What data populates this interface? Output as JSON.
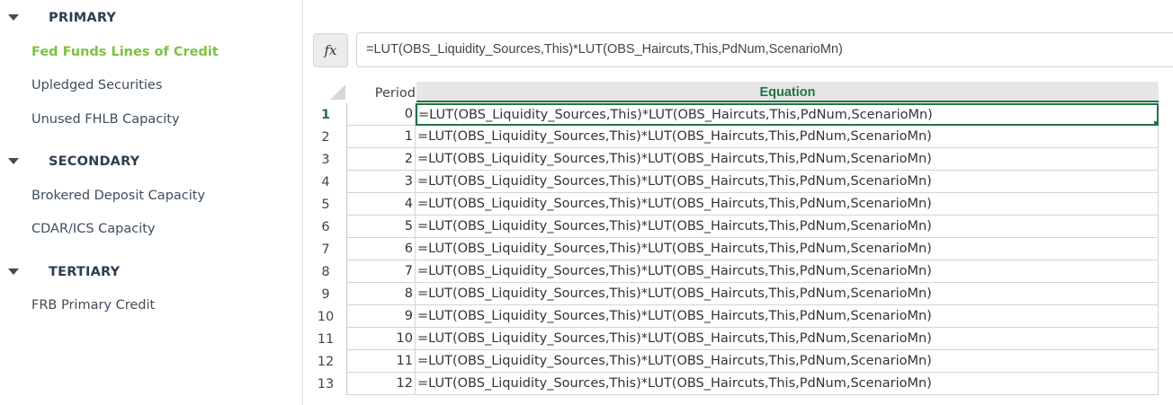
{
  "sidebar": {
    "groups": [
      {
        "title": "PRIMARY",
        "items": [
          "Fed Funds Lines of Credit",
          "Upledged Securities",
          "Unused FHLB Capacity"
        ]
      },
      {
        "title": "SECONDARY",
        "items": [
          "Brokered Deposit Capacity",
          "CDAR/ICS Capacity"
        ]
      },
      {
        "title": "TERTIARY",
        "items": [
          "FRB Primary Credit"
        ]
      }
    ],
    "active_item": "Fed Funds Lines of Credit"
  },
  "formula_bar": {
    "fx_label": "fx",
    "value": "=LUT(OBS_Liquidity_Sources,This)*LUT(OBS_Haircuts,This,PdNum,ScenarioMn)"
  },
  "grid": {
    "columns": [
      "Period",
      "Equation"
    ],
    "rows": [
      {
        "num": "1",
        "period": "0",
        "equation": "=LUT(OBS_Liquidity_Sources,This)*LUT(OBS_Haircuts,This,PdNum,ScenarioMn)"
      },
      {
        "num": "2",
        "period": "1",
        "equation": "=LUT(OBS_Liquidity_Sources,This)*LUT(OBS_Haircuts,This,PdNum,ScenarioMn)"
      },
      {
        "num": "3",
        "period": "2",
        "equation": "=LUT(OBS_Liquidity_Sources,This)*LUT(OBS_Haircuts,This,PdNum,ScenarioMn)"
      },
      {
        "num": "4",
        "period": "3",
        "equation": "=LUT(OBS_Liquidity_Sources,This)*LUT(OBS_Haircuts,This,PdNum,ScenarioMn)"
      },
      {
        "num": "5",
        "period": "4",
        "equation": "=LUT(OBS_Liquidity_Sources,This)*LUT(OBS_Haircuts,This,PdNum,ScenarioMn)"
      },
      {
        "num": "6",
        "period": "5",
        "equation": "=LUT(OBS_Liquidity_Sources,This)*LUT(OBS_Haircuts,This,PdNum,ScenarioMn)"
      },
      {
        "num": "7",
        "period": "6",
        "equation": "=LUT(OBS_Liquidity_Sources,This)*LUT(OBS_Haircuts,This,PdNum,ScenarioMn)"
      },
      {
        "num": "8",
        "period": "7",
        "equation": "=LUT(OBS_Liquidity_Sources,This)*LUT(OBS_Haircuts,This,PdNum,ScenarioMn)"
      },
      {
        "num": "9",
        "period": "8",
        "equation": "=LUT(OBS_Liquidity_Sources,This)*LUT(OBS_Haircuts,This,PdNum,ScenarioMn)"
      },
      {
        "num": "10",
        "period": "9",
        "equation": "=LUT(OBS_Liquidity_Sources,This)*LUT(OBS_Haircuts,This,PdNum,ScenarioMn)"
      },
      {
        "num": "11",
        "period": "10",
        "equation": "=LUT(OBS_Liquidity_Sources,This)*LUT(OBS_Haircuts,This,PdNum,ScenarioMn)"
      },
      {
        "num": "12",
        "period": "11",
        "equation": "=LUT(OBS_Liquidity_Sources,This)*LUT(OBS_Haircuts,This,PdNum,ScenarioMn)"
      },
      {
        "num": "13",
        "period": "12",
        "equation": "=LUT(OBS_Liquidity_Sources,This)*LUT(OBS_Haircuts,This,PdNum,ScenarioMn)"
      }
    ],
    "selected_row": 1
  },
  "colors": {
    "active_nav": "#7cc243",
    "grid_accent": "#217346",
    "group_title": "#2d3e4f"
  }
}
